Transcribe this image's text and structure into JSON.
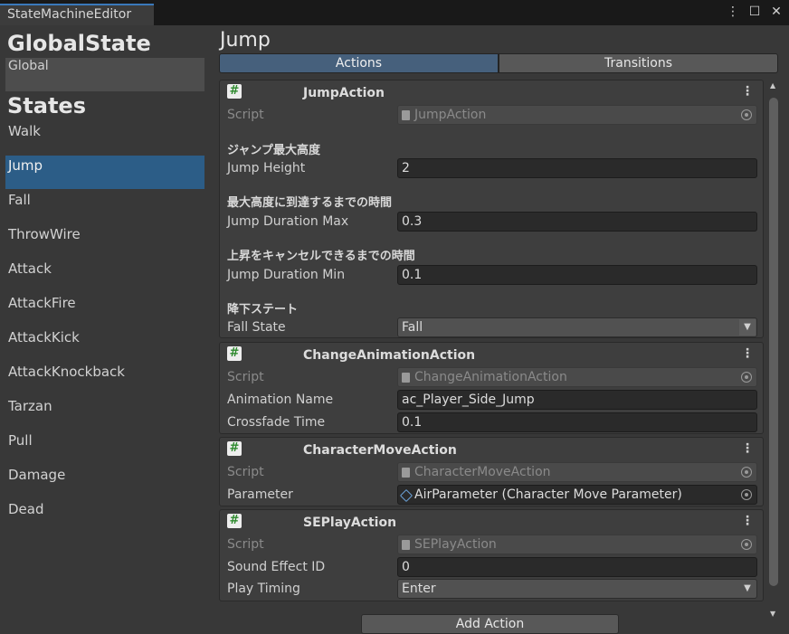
{
  "window": {
    "tab_title": "StateMachineEditor"
  },
  "left": {
    "global_header": "GlobalState",
    "global_value": "Global",
    "states_header": "States",
    "states": [
      "Walk",
      "Jump",
      "Fall",
      "ThrowWire",
      "Attack",
      "AttackFire",
      "AttackKick",
      "AttackKnockback",
      "Tarzan",
      "Pull",
      "Damage",
      "Dead"
    ],
    "selected_state": "Jump"
  },
  "main": {
    "title": "Jump",
    "tabs": {
      "actions": "Actions",
      "transitions": "Transitions"
    },
    "add_button": "Add Action"
  },
  "jump_action": {
    "title": "JumpAction",
    "script_label": "Script",
    "script_value": "JumpAction",
    "h1": "ジャンプ最大高度",
    "f1_label": "Jump Height",
    "f1_value": "2",
    "h2": "最大高度に到達するまでの時間",
    "f2_label": "Jump Duration Max",
    "f2_value": "0.3",
    "h3": "上昇をキャンセルできるまでの時間",
    "f3_label": "Jump Duration Min",
    "f3_value": "0.1",
    "h4": "降下ステート",
    "f4_label": "Fall State",
    "f4_value": "Fall"
  },
  "change_anim_action": {
    "title": "ChangeAnimationAction",
    "script_label": "Script",
    "script_value": "ChangeAnimationAction",
    "f1_label": "Animation Name",
    "f1_value": "ac_Player_Side_Jump",
    "f2_label": "Crossfade Time",
    "f2_value": "0.1"
  },
  "char_move_action": {
    "title": "CharacterMoveAction",
    "script_label": "Script",
    "script_value": "CharacterMoveAction",
    "f1_label": "Parameter",
    "f1_value": "AirParameter (Character Move Parameter)"
  },
  "se_play_action": {
    "title": "SEPlayAction",
    "script_label": "Script",
    "script_value": "SEPlayAction",
    "f1_label": "Sound Effect ID",
    "f1_value": "0",
    "f2_label": "Play Timing",
    "f2_value": "Enter"
  },
  "icons": [
    "kebab-menu-icon",
    "maximize-icon",
    "close-icon",
    "script-hash-icon",
    "object-picker-icon",
    "dropdown-caret-icon",
    "scroll-up-icon",
    "scroll-down-icon"
  ],
  "colors": {
    "selection": "#2c5d87",
    "active_tab": "#46607c",
    "background": "#383838",
    "script_icon": "#2e8a2e"
  }
}
